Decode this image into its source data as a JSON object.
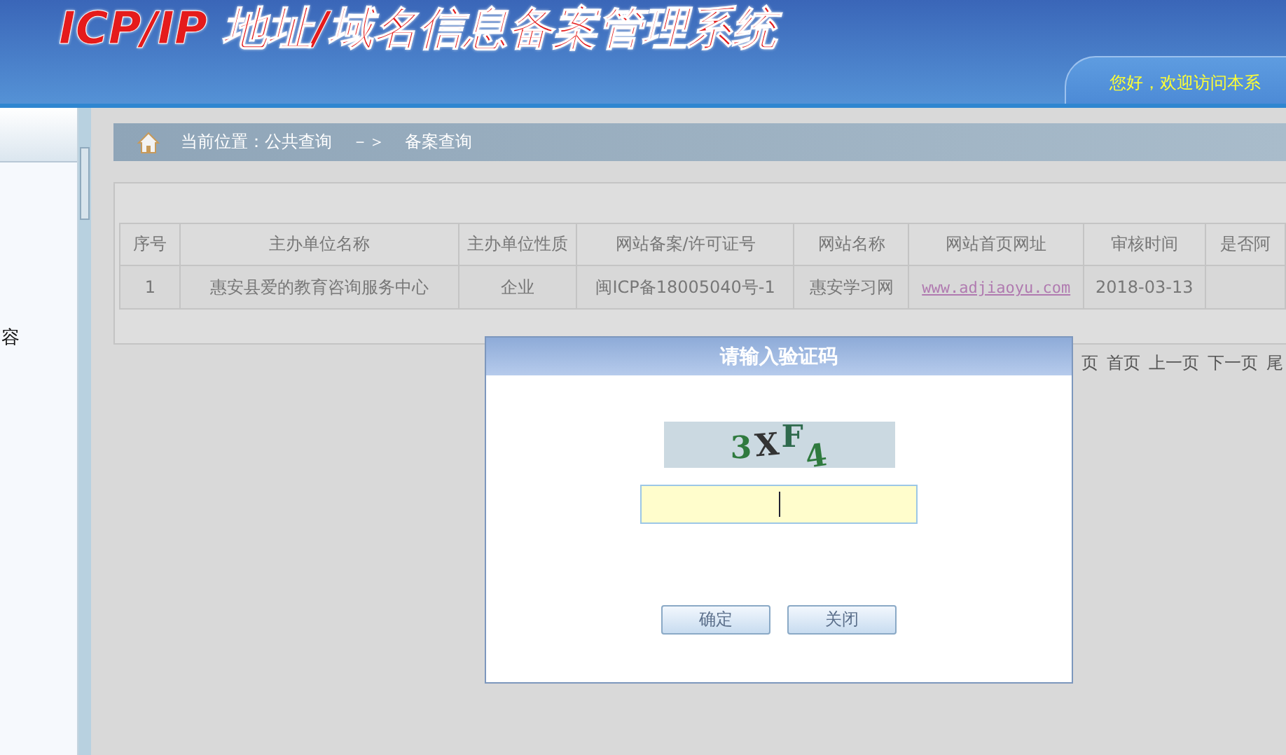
{
  "header": {
    "title": "ICP/IP 地址/域名信息备案管理系统",
    "welcome": "您好，欢迎访问本系"
  },
  "sidebar": {
    "item": "容"
  },
  "breadcrumb": {
    "label": "当前位置：公共查询",
    "arrow": "－＞",
    "current": "备案查询"
  },
  "table": {
    "columns": [
      "序号",
      "主办单位名称",
      "主办单位性质",
      "网站备案/许可证号",
      "网站名称",
      "网站首页网址",
      "审核时间",
      "是否阿"
    ],
    "rows": [
      {
        "cells": [
          {
            "text": "1",
            "kind": "text"
          },
          {
            "text": "惠安县爱的教育咨询服务中心",
            "kind": "text"
          },
          {
            "text": "企业",
            "kind": "text"
          },
          {
            "text": "闽ICP备18005040号-1",
            "kind": "text"
          },
          {
            "text": "惠安学习网",
            "kind": "text"
          },
          {
            "text": "www.adjiaoyu.com",
            "kind": "link"
          },
          {
            "text": "2018-03-13",
            "kind": "text"
          }
        ]
      }
    ]
  },
  "pager": [
    "页",
    "首页",
    "上一页",
    "下一页",
    "尾"
  ],
  "dialog": {
    "title": "请输入验证码",
    "captcha": "3XF4",
    "buttons": [
      "确定",
      "关闭"
    ]
  }
}
